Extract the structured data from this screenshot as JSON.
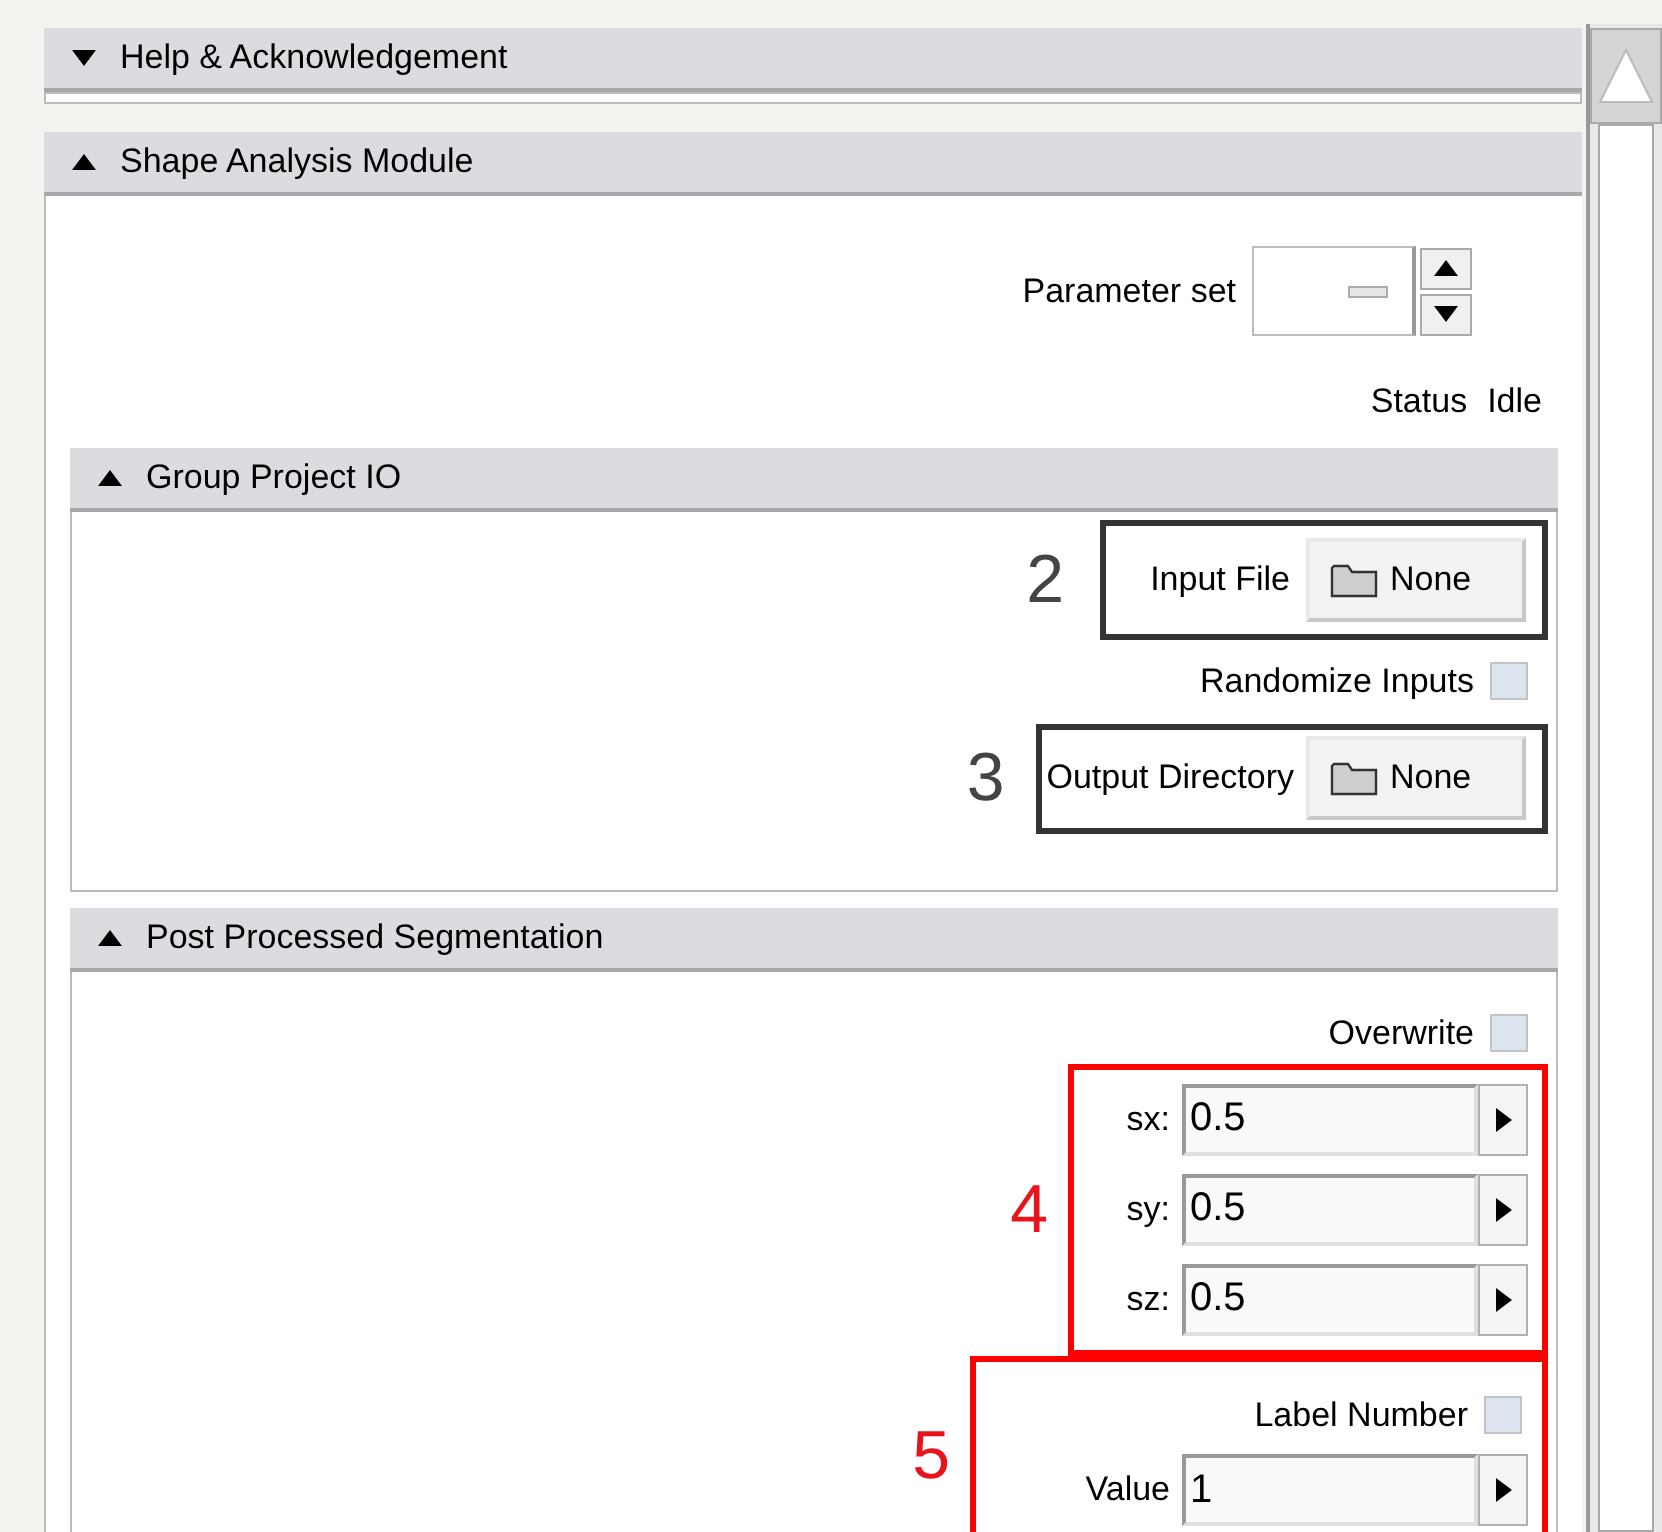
{
  "panels": [
    {
      "title": "Help & Acknowledgement",
      "expanded": false
    },
    {
      "title": "Shape Analysis Module",
      "expanded": true
    }
  ],
  "parameter_set": {
    "label": "Parameter set"
  },
  "status": {
    "label": "Status",
    "value": "Idle"
  },
  "group_project_io": {
    "title": "Group Project IO",
    "expanded": true,
    "input_file": {
      "callout": "2",
      "label": "Input File",
      "value": "None"
    },
    "randomize_inputs": {
      "label": "Randomize Inputs",
      "checked": false
    },
    "output_directory": {
      "callout": "3",
      "label": "Output Directory",
      "value": "None"
    }
  },
  "post_processed_segmentation": {
    "title": "Post Processed Segmentation",
    "expanded": true,
    "overwrite": {
      "label": "Overwrite",
      "checked": false
    },
    "scale": {
      "callout": "4",
      "fields": [
        {
          "label": "sx:",
          "value": "0.5"
        },
        {
          "label": "sy:",
          "value": "0.5"
        },
        {
          "label": "sz:",
          "value": "0.5"
        }
      ]
    },
    "label_group": {
      "callout": "5",
      "label_number": {
        "label": "Label Number",
        "checked": false
      },
      "value": {
        "label": "Value",
        "value": "1"
      }
    }
  }
}
